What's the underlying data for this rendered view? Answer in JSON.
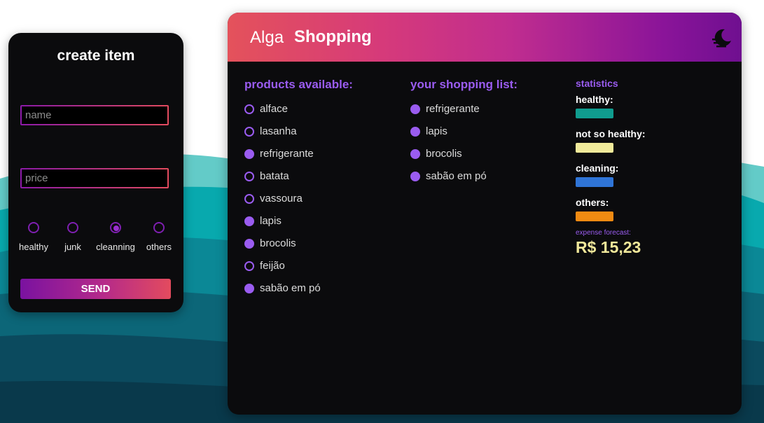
{
  "create": {
    "title": "create item",
    "name_placeholder": "name",
    "price_placeholder": "price",
    "categories": [
      {
        "label": "healthy",
        "checked": false
      },
      {
        "label": "junk",
        "checked": false
      },
      {
        "label": "cleanning",
        "checked": true
      },
      {
        "label": "others",
        "checked": false
      }
    ],
    "send_label": "SEND"
  },
  "header": {
    "brand_light": "Alga",
    "brand_bold": "Shopping",
    "theme_icon": "moon-icon"
  },
  "products": {
    "title": "products available:",
    "items": [
      {
        "label": "alface",
        "in_list": false
      },
      {
        "label": "lasanha",
        "in_list": false
      },
      {
        "label": "refrigerante",
        "in_list": true
      },
      {
        "label": "batata",
        "in_list": false
      },
      {
        "label": "vassoura",
        "in_list": false
      },
      {
        "label": "lapis",
        "in_list": true
      },
      {
        "label": "brocolis",
        "in_list": true
      },
      {
        "label": "feijão",
        "in_list": false
      },
      {
        "label": "sabão em pó",
        "in_list": true
      }
    ]
  },
  "shopping_list": {
    "title": "your shopping list:",
    "items": [
      {
        "label": "refrigerante"
      },
      {
        "label": "lapis"
      },
      {
        "label": "brocolis"
      },
      {
        "label": "sabão em pó"
      }
    ]
  },
  "statistics": {
    "title": "statistics",
    "entries": [
      {
        "label": "healthy:",
        "color": "#109c8e"
      },
      {
        "label": "not so healthy:",
        "color": "#f1ea9a"
      },
      {
        "label": "cleaning:",
        "color": "#2f74d6"
      },
      {
        "label": "others:",
        "color": "#f08a12"
      }
    ],
    "forecast_label": "expense forecast:",
    "forecast_value": "R$ 15,23"
  },
  "colors": {
    "accent": "#9a5cf0",
    "gradient_start": "#e4525b",
    "gradient_end": "#6f0f90",
    "card_bg": "#0b0b0d"
  }
}
